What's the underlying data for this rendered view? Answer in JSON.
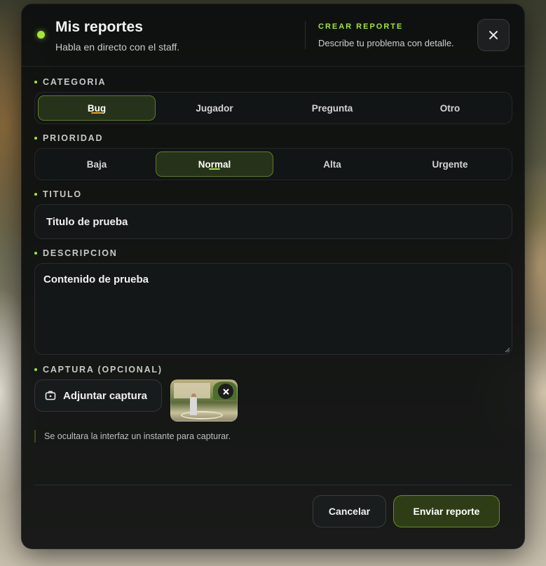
{
  "header": {
    "title": "Mis reportes",
    "subtitle": "Habla en directo con el staff.",
    "kicker": "CREAR REPORTE",
    "kicker_sub": "Describe tu problema con detalle."
  },
  "category": {
    "label": "CATEGORIA",
    "options": [
      "Bug",
      "Jugador",
      "Pregunta",
      "Otro"
    ],
    "selected": "Bug"
  },
  "priority": {
    "label": "PRIORIDAD",
    "options": [
      "Baja",
      "Normal",
      "Alta",
      "Urgente"
    ],
    "selected": "Normal"
  },
  "title_field": {
    "label": "TITULO",
    "value": "Titulo de prueba"
  },
  "description_field": {
    "label": "DESCRIPCION",
    "value": "Contenido de prueba"
  },
  "capture": {
    "label": "CAPTURA (OPCIONAL)",
    "attach_label": "Adjuntar captura",
    "hint": "Se ocultara la interfaz un instante para capturar."
  },
  "footer": {
    "cancel_label": "Cancelar",
    "submit_label": "Enviar reporte"
  },
  "colors": {
    "accent": "#a3e635",
    "category_underline": "#e8a317",
    "priority_underline": "#a3e635"
  },
  "icons": {
    "close": "close-icon",
    "camera": "camera-icon",
    "remove": "remove-icon"
  }
}
